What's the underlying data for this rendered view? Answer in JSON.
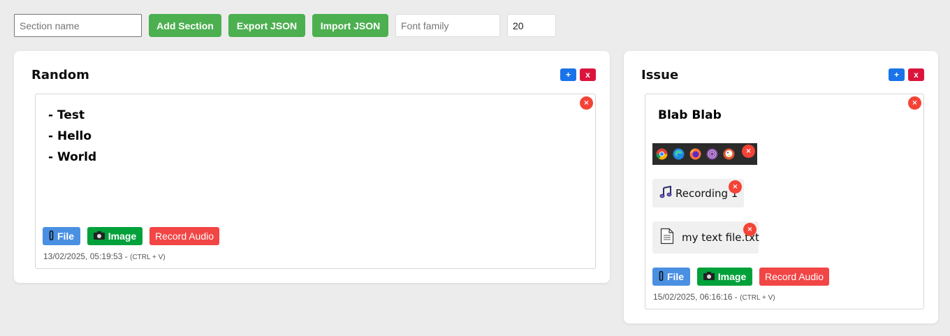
{
  "toolbar": {
    "section_placeholder": "Section name",
    "add_section": "Add Section",
    "export_json": "Export JSON",
    "import_json": "Import JSON",
    "font_placeholder": "Font family",
    "font_size": "20"
  },
  "section_controls": {
    "add": "+",
    "remove": "x"
  },
  "card_close": "×",
  "sections": [
    {
      "title": "Random",
      "note": {
        "lines": [
          "- Test",
          "- Hello",
          "- World"
        ],
        "buttons": {
          "file": "File",
          "image": "Image",
          "record": "Record Audio"
        },
        "timestamp": "13/02/2025, 05:19:53 - ",
        "shortcut": "(CTRL + V)"
      }
    },
    {
      "title": "Issue",
      "note": {
        "lines": [
          "Blab Blab"
        ],
        "browser_icons": [
          "chrome-icon",
          "edge-icon",
          "firefox-icon",
          "tor-icon",
          "duckduckgo-icon",
          "blank-icon"
        ],
        "attachments": [
          {
            "type": "audio",
            "icon": "music-note-icon",
            "label": "Recording 1"
          },
          {
            "type": "file",
            "icon": "document-icon",
            "label": "my text file.txt"
          }
        ],
        "buttons": {
          "file": "File",
          "image": "Image",
          "record": "Record Audio"
        },
        "timestamp": "15/02/2025, 06:16:16 - ",
        "shortcut": "(CTRL + V)"
      }
    }
  ],
  "colors": {
    "page_bg": "#ececec",
    "toolbar_button": "#4caf50",
    "section_add": "#1a73e8",
    "section_remove": "#dc143c",
    "file_button": "#4a90e2",
    "image_button": "#00a13a",
    "record_button": "#f24545",
    "close_dot": "#f44336"
  }
}
